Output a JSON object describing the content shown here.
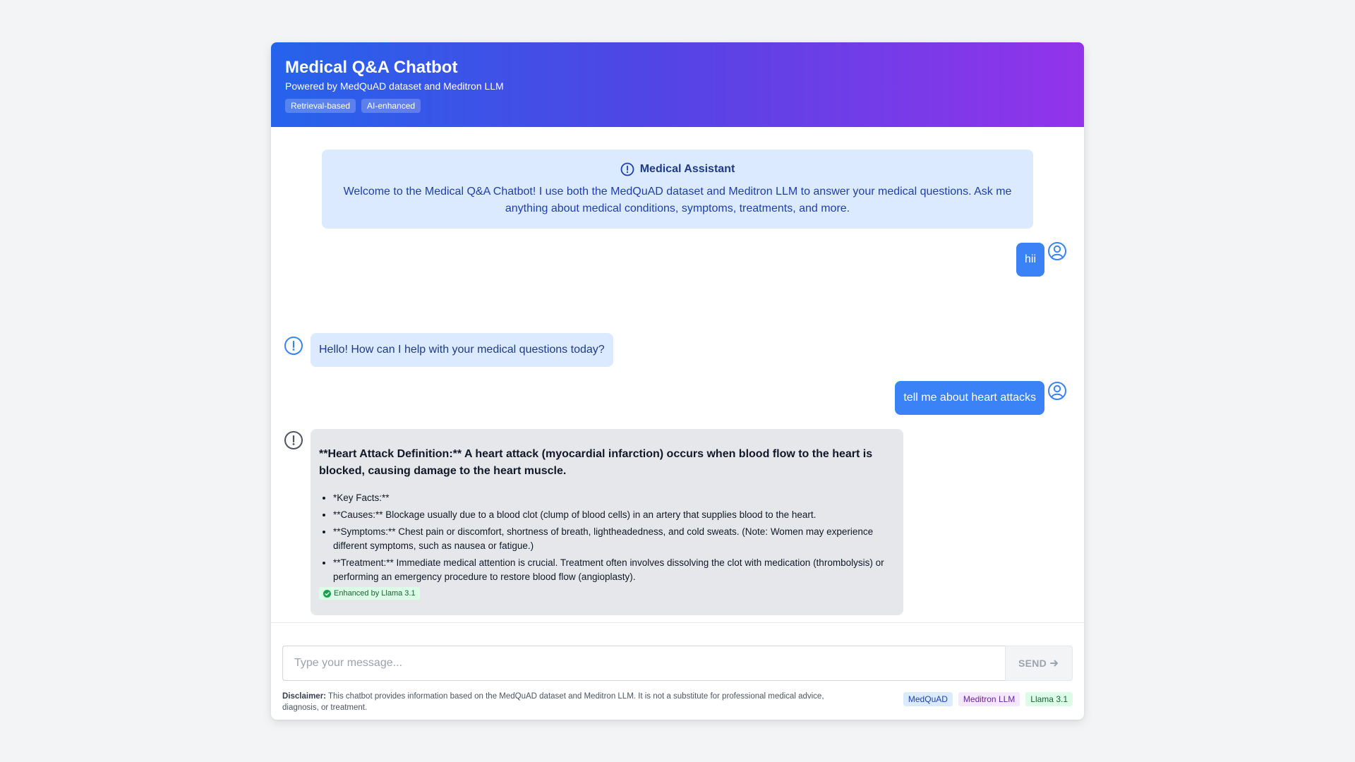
{
  "header": {
    "title": "Medical Q&A Chatbot",
    "subtitle": "Powered by MedQuAD dataset and Meditron LLM",
    "badges": [
      "Retrieval-based",
      "AI-enhanced"
    ]
  },
  "welcome": {
    "title": "Medical Assistant",
    "text": "Welcome to the Medical Q&A Chatbot! I use both the MedQuAD dataset and Meditron LLM to answer your medical questions. Ask me anything about medical conditions, symptoms, treatments, and more."
  },
  "messages": [
    {
      "role": "user",
      "text": "hii"
    },
    {
      "role": "bot",
      "text": "Hello! How can I help with your medical questions today?"
    },
    {
      "role": "user",
      "text": "tell me about heart attacks"
    },
    {
      "role": "bot",
      "heading": "**Heart Attack Definition:** A heart attack (myocardial infarction) occurs when blood flow to the heart is blocked, causing damage to the heart muscle.",
      "bullets": [
        "*Key Facts:**",
        "**Causes:** Blockage usually due to a blood clot (clump of blood cells) in an artery that supplies blood to the heart.",
        "**Symptoms:** Chest pain or discomfort, shortness of breath, lightheadedness, and cold sweats. (Note: Women may experience different symptoms, such as nausea or fatigue.)",
        "**Treatment:** Immediate medical attention is crucial. Treatment often involves dissolving the clot with medication (thrombolysis) or performing an emergency procedure to restore blood flow (angioplasty)."
      ],
      "enhanced_label": "Enhanced by Llama 3.1"
    }
  ],
  "input": {
    "placeholder": "Type your message...",
    "value": "",
    "send_label": "SEND"
  },
  "disclaimer": {
    "label": "Disclaimer:",
    "text": " This chatbot provides information based on the MedQuAD dataset and Meditron LLM. It is not a substitute for professional medical advice, diagnosis, or treatment."
  },
  "tags": [
    "MedQuAD",
    "Meditron LLM",
    "Llama 3.1"
  ],
  "colors": {
    "header_gradient_start": "#2563eb",
    "header_gradient_end": "#9333ea",
    "user_bubble": "#3b82f6",
    "bot_bubble": "#dbeafe",
    "bot_long_bubble": "#e5e7eb"
  }
}
